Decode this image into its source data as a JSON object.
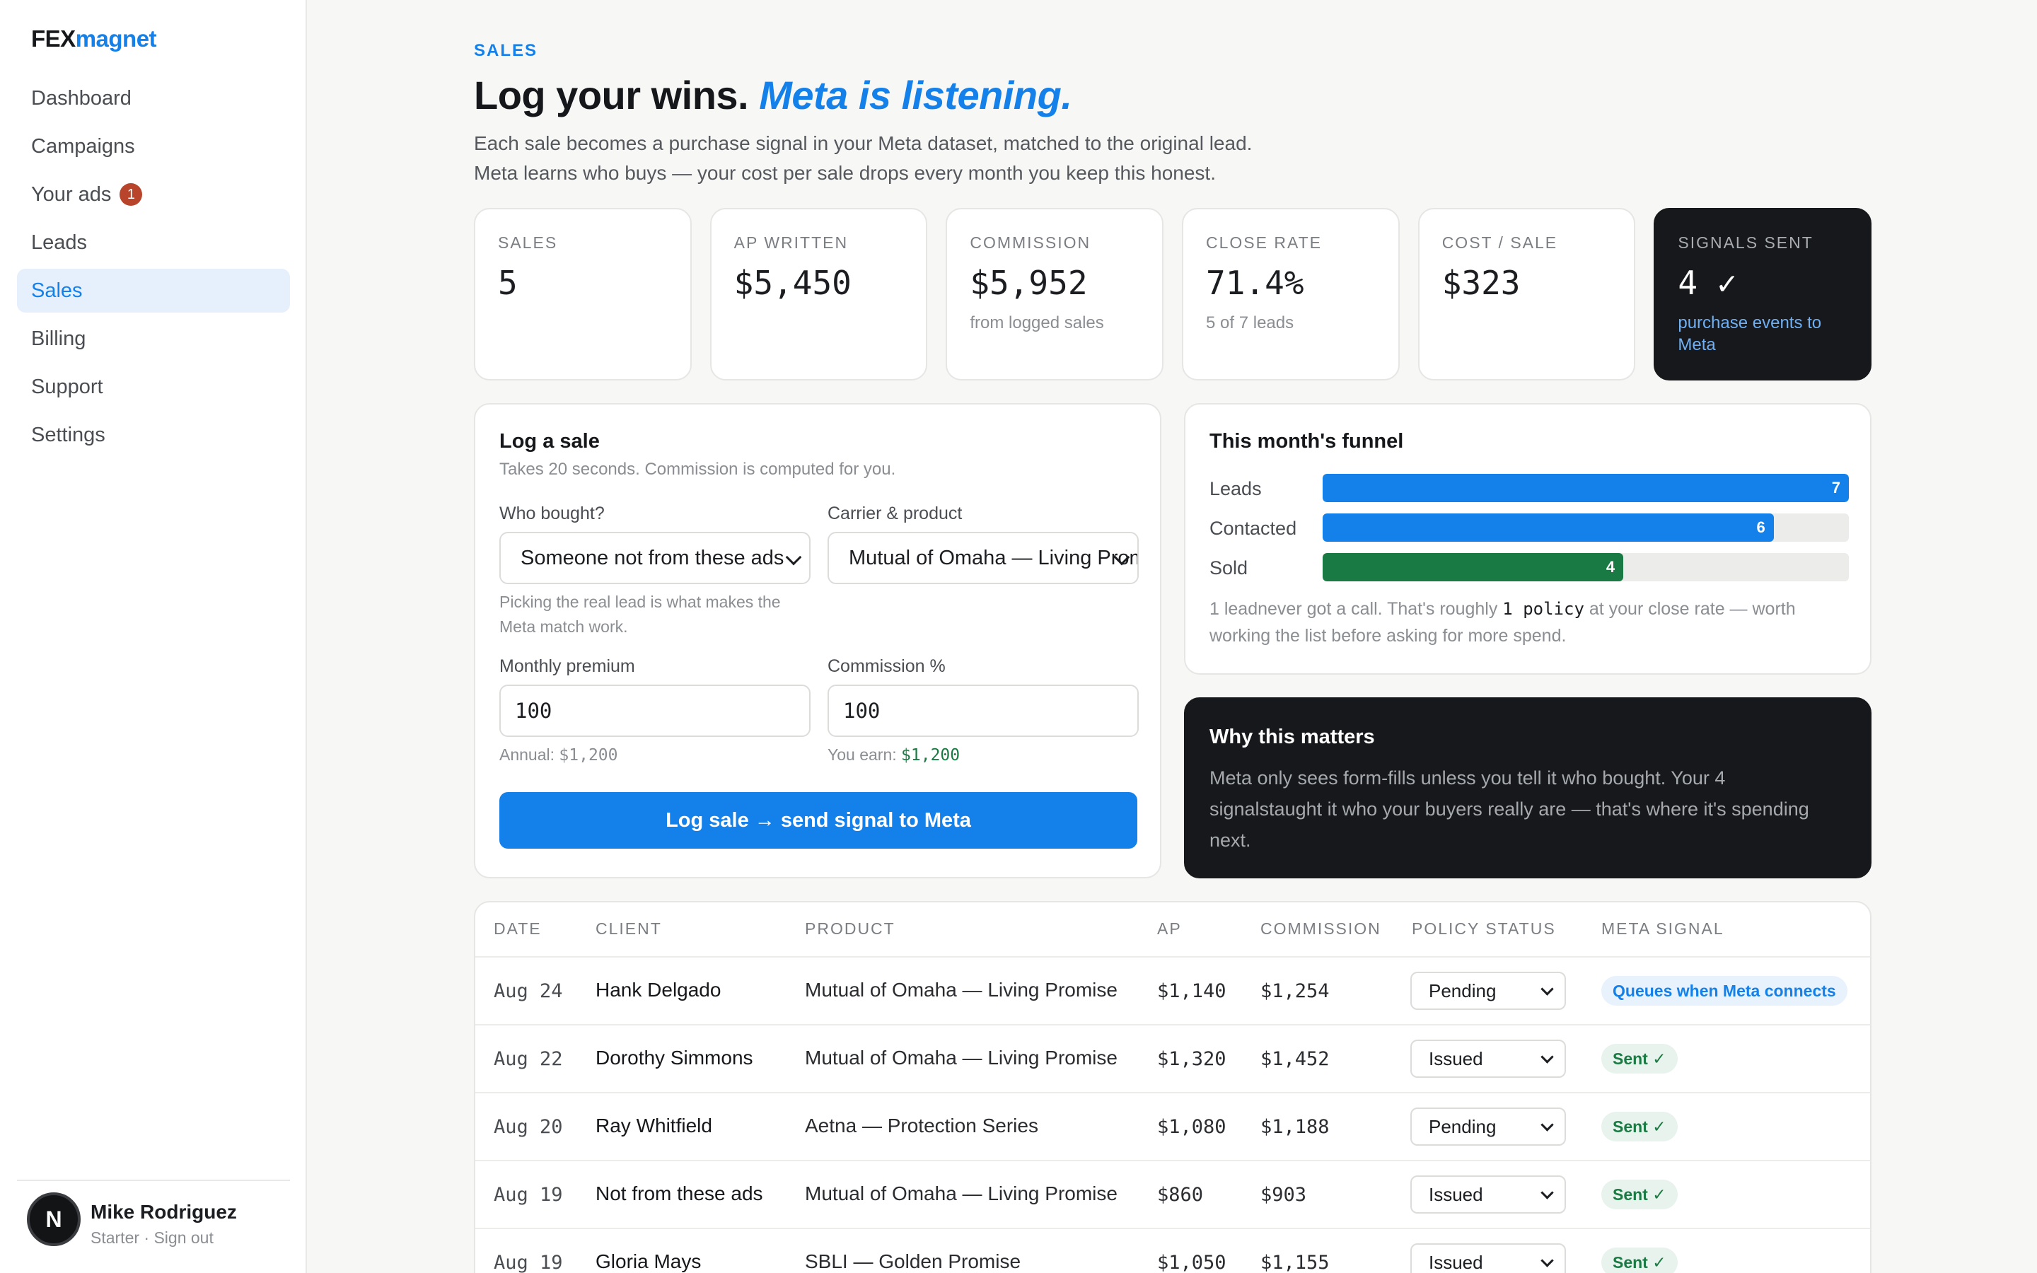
{
  "brand": {
    "part1": "FEX",
    "part2": "magnet"
  },
  "nav": [
    {
      "label": "Dashboard",
      "badge": ""
    },
    {
      "label": "Campaigns",
      "badge": ""
    },
    {
      "label": "Your ads",
      "badge": "1"
    },
    {
      "label": "Leads",
      "badge": ""
    },
    {
      "label": "Sales",
      "badge": "",
      "active": true
    },
    {
      "label": "Billing",
      "badge": ""
    },
    {
      "label": "Support",
      "badge": ""
    },
    {
      "label": "Settings",
      "badge": ""
    }
  ],
  "user": {
    "initial": "N",
    "name": "Mike Rodriguez",
    "plan": "Starter · Sign out"
  },
  "header": {
    "eyebrow": "SALES",
    "title": "Log your wins.",
    "title_accent": "Meta is listening.",
    "sub1": "Each sale becomes a purchase signal in your Meta dataset, matched to the original lead.",
    "sub2": "Meta learns who buys — your cost per sale drops every month you keep this honest."
  },
  "stats": [
    {
      "label": "SALES",
      "value": "5",
      "note": ""
    },
    {
      "label": "AP WRITTEN",
      "value": "$5,450",
      "note": ""
    },
    {
      "label": "COMMISSION",
      "value": "$5,952",
      "note": "from logged sales"
    },
    {
      "label": "CLOSE RATE",
      "value": "71.4%",
      "note": "5 of 7 leads"
    },
    {
      "label": "COST / SALE",
      "value": "$323",
      "note": ""
    },
    {
      "label": "SIGNALS SENT",
      "value": "4 ✓",
      "note": "purchase events to Meta"
    }
  ],
  "log_sale": {
    "title": "Log a sale",
    "subtitle": "Takes 20 seconds. Commission is computed for you.",
    "who_label": "Who bought?",
    "who_value": "Someone not from these ads",
    "who_hint": "Picking the real lead is what makes the Meta match work.",
    "carrier_label": "Carrier & product",
    "carrier_value": "Mutual of Omaha — Living Promise",
    "premium_label": "Monthly premium",
    "premium_value": "100",
    "premium_hint_prefix": "Annual: ",
    "premium_hint_value": "$1,200",
    "commission_label": "Commission %",
    "commission_value": "100",
    "commission_hint_prefix": "You earn: ",
    "commission_hint_value": "$1,200",
    "submit_label": "Log sale → send signal to Meta"
  },
  "funnel": {
    "title": "This month's funnel",
    "rows": [
      {
        "label": "Leads",
        "value": 7,
        "color": "#1480ea"
      },
      {
        "label": "Contacted",
        "value": 6,
        "color": "#1480ea"
      },
      {
        "label": "Sold",
        "value": 4,
        "color": "#1a7a43"
      }
    ],
    "max": 7,
    "note_a": "1 leadnever got a call. That's roughly ",
    "note_code": "1 policy",
    "note_b": " at your close rate — worth working the list before asking for more spend."
  },
  "why": {
    "title": "Why this matters",
    "text": "Meta only sees form-fills unless you tell it who bought. Your 4 signalstaught it who your buyers really are — that's where it's spending next."
  },
  "table": {
    "headers": [
      "DATE",
      "CLIENT",
      "PRODUCT",
      "AP",
      "COMMISSION",
      "POLICY STATUS",
      "META SIGNAL"
    ],
    "rows": [
      {
        "date": "Aug 24",
        "client": "Hank Delgado",
        "product": "Mutual of Omaha — Living Promise",
        "ap": "$1,140",
        "commission": "$1,254",
        "status": "Pending",
        "signal": "Queues when Meta connects",
        "signal_type": "queue"
      },
      {
        "date": "Aug 22",
        "client": "Dorothy Simmons",
        "product": "Mutual of Omaha — Living Promise",
        "ap": "$1,320",
        "commission": "$1,452",
        "status": "Issued",
        "signal": "Sent ✓",
        "signal_type": "sent"
      },
      {
        "date": "Aug 20",
        "client": "Ray Whitfield",
        "product": "Aetna — Protection Series",
        "ap": "$1,080",
        "commission": "$1,188",
        "status": "Pending",
        "signal": "Sent ✓",
        "signal_type": "sent"
      },
      {
        "date": "Aug 19",
        "client": "Not from these ads",
        "product": "Mutual of Omaha — Living Promise",
        "ap": "$860",
        "commission": "$903",
        "status": "Issued",
        "signal": "Sent ✓",
        "signal_type": "sent"
      },
      {
        "date": "Aug 19",
        "client": "Gloria Mays",
        "product": "SBLI — Golden Promise",
        "ap": "$1,050",
        "commission": "$1,155",
        "status": "Issued",
        "signal": "Sent ✓",
        "signal_type": "sent"
      }
    ]
  }
}
